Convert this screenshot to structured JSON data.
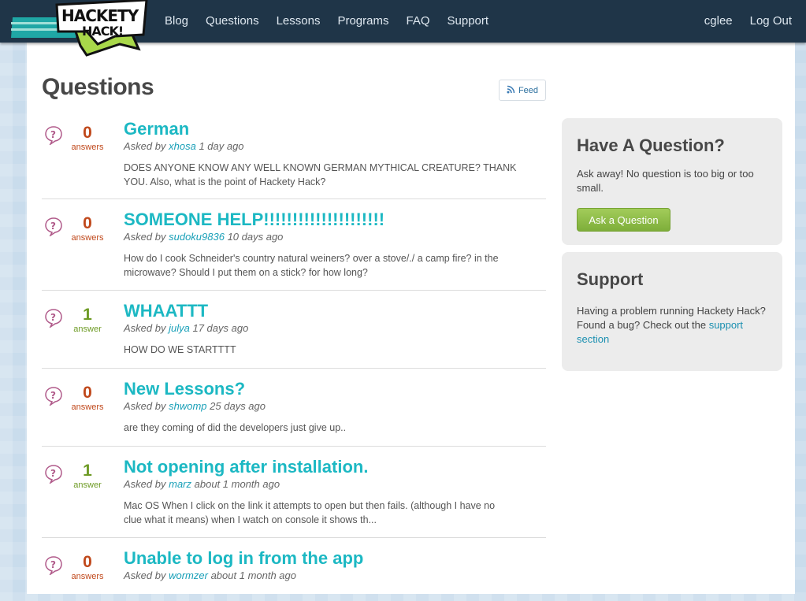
{
  "brand": {
    "logo_text_top": "HACKETY",
    "logo_text_bottom": "HACK!"
  },
  "nav": {
    "items": [
      "Blog",
      "Questions",
      "Lessons",
      "Programs",
      "FAQ",
      "Support"
    ]
  },
  "user": {
    "name": "cglee",
    "logout_label": "Log Out"
  },
  "main": {
    "title": "Questions",
    "feed_label": "Feed",
    "asked_by_prefix": "Asked by",
    "questions": [
      {
        "count": "0",
        "count_label": "answers",
        "title": "German",
        "author": "xhosa",
        "time": "1 day ago",
        "text": "DOES ANYONE KNOW ANY WELL KNOWN GERMAN MYTHICAL CREATURE? THANK YOU. Also, what is the point of Hackety Hack?"
      },
      {
        "count": "0",
        "count_label": "answers",
        "title": "SOMEONE HELP!!!!!!!!!!!!!!!!!!!!!",
        "author": "sudoku9836",
        "time": "10 days ago",
        "text": "How do I cook Schneider's country natural weiners? over a stove/./ a camp fire? in the microwave? Should I put them on a stick? for how long?"
      },
      {
        "count": "1",
        "count_label": "answer",
        "title": "WHAATTT",
        "author": "julya",
        "time": "17 days ago",
        "text": "HOW DO WE STARTTTT"
      },
      {
        "count": "0",
        "count_label": "answers",
        "title": "New Lessons?",
        "author": "shwomp",
        "time": "25 days ago",
        "text": "are they coming of did the developers just give up.."
      },
      {
        "count": "1",
        "count_label": "answer",
        "title": "Not opening after installation.",
        "author": "marz",
        "time": "about 1 month ago",
        "text": "Mac OS When I click on the link it attempts to open but then fails. (although I have no clue what it means) when I watch on console it shows th..."
      },
      {
        "count": "0",
        "count_label": "answers",
        "title": "Unable to log in from the app",
        "author": "wormzer",
        "time": "about 1 month ago",
        "text": ""
      }
    ]
  },
  "sidebar": {
    "ask_box": {
      "title": "Have A Question?",
      "text": "Ask away! No question is too big or too small.",
      "button_label": "Ask a Question"
    },
    "support_box": {
      "title": "Support",
      "text": "Having a problem running Hackety Hack? Found a bug? Check out the",
      "link_text": "support section"
    }
  },
  "colors": {
    "topbar": "#1f3548",
    "title_link": "#1cb8c3",
    "zero_count": "#c0481b",
    "one_count": "#6e9b25",
    "button": "#8dbb45"
  }
}
